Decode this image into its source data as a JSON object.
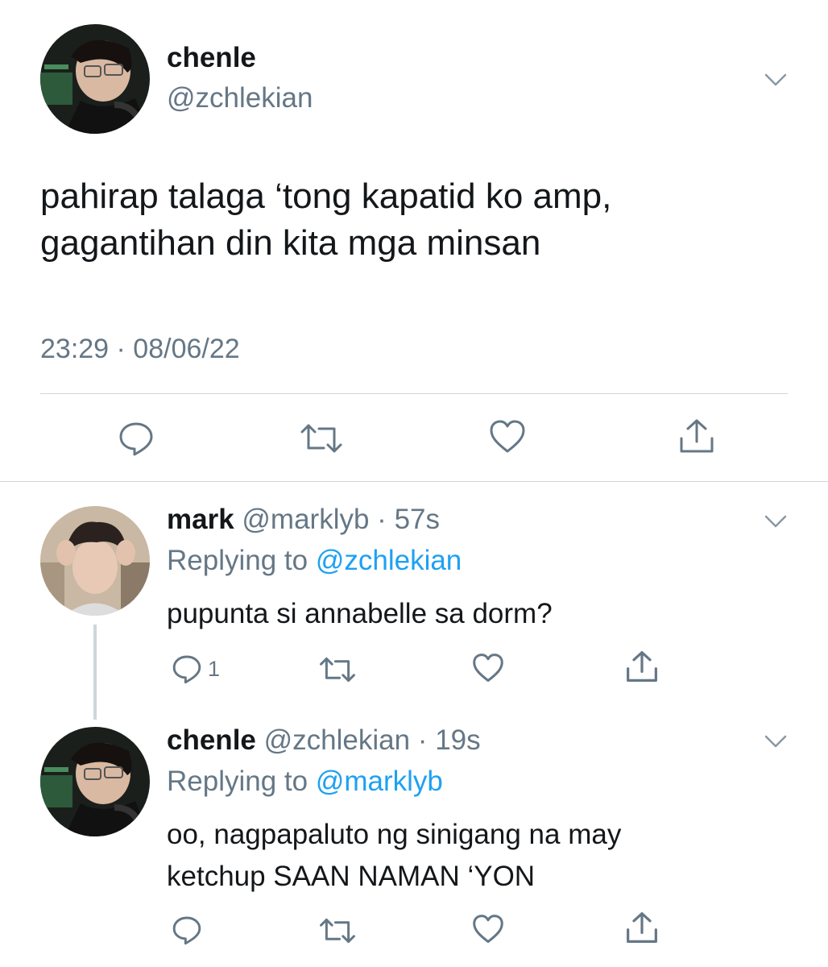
{
  "main_tweet": {
    "name": "chenle",
    "handle": "@zchlekian",
    "text_lines": [
      "pahirap talaga ‘tong kapatid ko amp,",
      "gagantihan din kita mga minsan"
    ],
    "timestamp": "23:29 · 08/06/22",
    "actions": [
      "reply-icon",
      "retweet-icon",
      "like-icon",
      "share-icon"
    ]
  },
  "replies": [
    {
      "name": "mark",
      "handle": "@marklyb",
      "time": "57s",
      "replying_prefix": "Replying to ",
      "replying_to": "@zchlekian",
      "text_lines": [
        "pupunta si annabelle sa dorm?"
      ],
      "reply_count": "1"
    },
    {
      "name": "chenle",
      "handle": "@zchlekian",
      "time": "19s",
      "replying_prefix": "Replying to ",
      "replying_to": "@marklyb",
      "text_lines": [
        "oo, nagpapaluto ng sinigang na may",
        "ketchup SAAN NAMAN ‘YON"
      ],
      "reply_count": ""
    }
  ],
  "separator": " · ",
  "colors": {
    "text": "#14171a",
    "secondary": "#657786",
    "link": "#1da1f2",
    "divider": "#ccd6dd"
  }
}
